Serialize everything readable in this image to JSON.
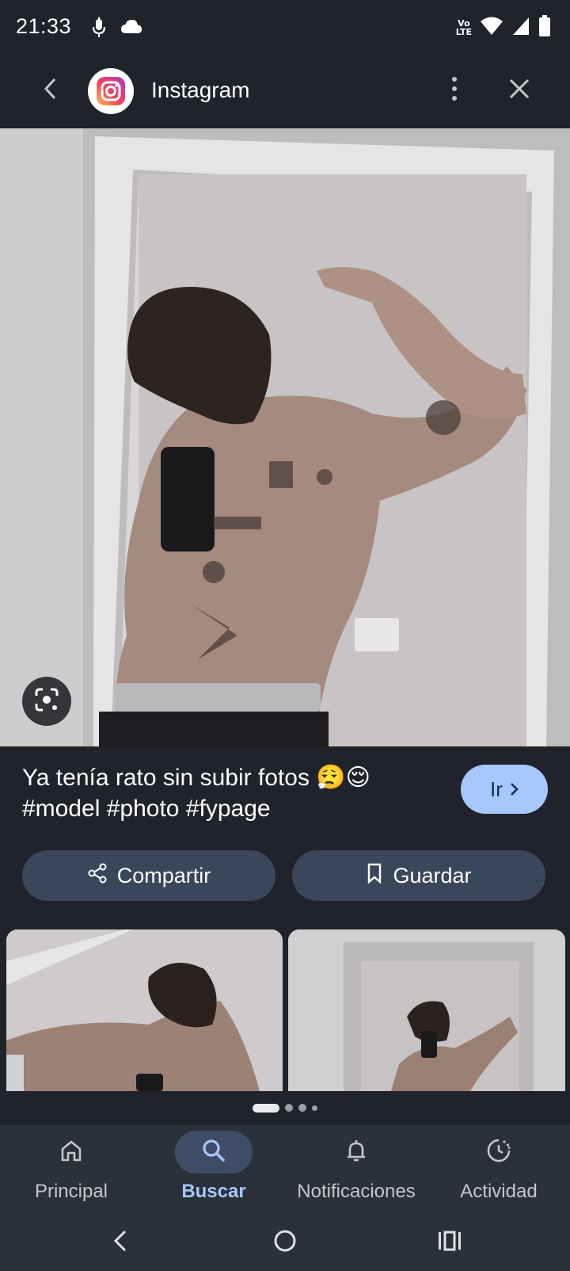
{
  "status_bar": {
    "time": "21:33",
    "icons": [
      "assistant-mic-icon",
      "cloud-icon",
      "volte-icon",
      "wifi-icon",
      "signal-icon",
      "battery-icon"
    ],
    "volte_label_top": "Vo",
    "volte_label_bottom": "LTE"
  },
  "header": {
    "app_name": "Instagram",
    "back_icon": "chevron-left-icon",
    "more_icon": "more-vert-icon",
    "close_icon": "close-icon"
  },
  "caption": {
    "text": "Ya tenía rato sin subir fotos 😮‍💨😌 #model #photo #fypage"
  },
  "go_button": {
    "label": "Ir",
    "icon": "chevron-right-icon"
  },
  "actions": {
    "share_label": "Compartir",
    "save_label": "Guardar"
  },
  "pager": {
    "count": 4,
    "active_index": 0
  },
  "bottom_nav": {
    "items": [
      {
        "label": "Principal",
        "icon": "home-icon",
        "active": false
      },
      {
        "label": "Buscar",
        "icon": "search-icon",
        "active": true
      },
      {
        "label": "Notificaciones",
        "icon": "bell-icon",
        "active": false
      },
      {
        "label": "Actividad",
        "icon": "activity-icon",
        "active": false
      }
    ]
  },
  "colors": {
    "background": "#20232b",
    "accent": "#a8c7fa",
    "button_bg": "#3a4659",
    "nav_bg": "#2b313b"
  }
}
